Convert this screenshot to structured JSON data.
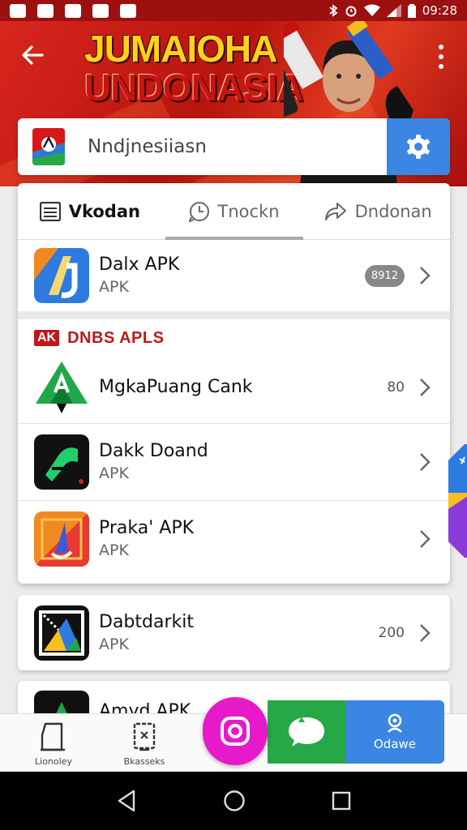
{
  "status_bar": {
    "time": "09:28"
  },
  "banner": {
    "line1": "JUMAIOHA",
    "line2": "UNDONASIA"
  },
  "search": {
    "value": "Nndjnesiiasn"
  },
  "tabs": [
    {
      "label": "Vkodan",
      "icon": "list-icon",
      "active": true
    },
    {
      "label": "Tnockn",
      "icon": "clock-icon",
      "active": false
    },
    {
      "label": "Dndonan",
      "icon": "share-icon",
      "active": false
    }
  ],
  "featured": {
    "name": "Dalx APK",
    "sub": "APK",
    "count": "8912"
  },
  "section": {
    "badge": "AK",
    "title": "DNBS APLS"
  },
  "list": [
    {
      "name": "MgkaPuang Cank",
      "sub": "",
      "count": "80"
    },
    {
      "name": "Dakk Doand",
      "sub": "APK",
      "count": ""
    },
    {
      "name": "Praka' APK",
      "sub": "APK",
      "count": ""
    }
  ],
  "card2": {
    "name": "Dabtdarkit",
    "sub": "APK",
    "count": "200"
  },
  "card3": {
    "name": "Amyd APK"
  },
  "bottom_nav": {
    "item1": "Lionoley",
    "item2": "Bkasseks",
    "blue": "Odawe"
  },
  "colors": {
    "brand_red": "#c01818",
    "accent_blue": "#3a86e2",
    "fab_pink": "#e61ac8",
    "green": "#25a845"
  }
}
